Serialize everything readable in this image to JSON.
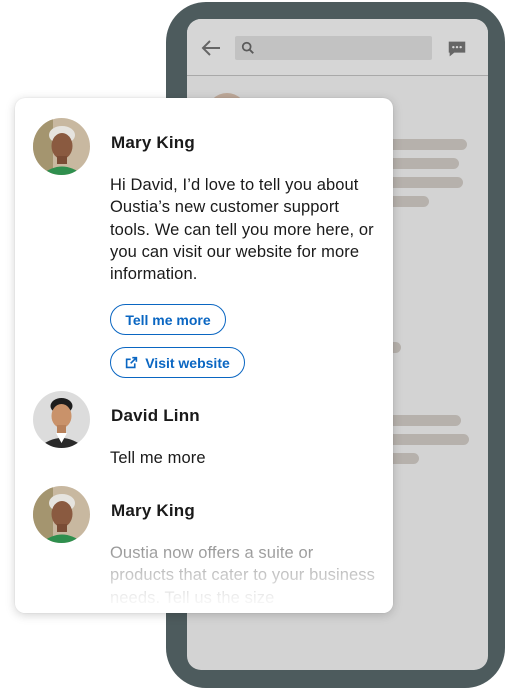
{
  "background_phone": {
    "icons": [
      "back-arrow-icon",
      "search-icon",
      "messaging-icon"
    ]
  },
  "conversation": {
    "messages": [
      {
        "sender": "Mary King",
        "avatar": "mary-king-avatar",
        "text": "Hi David, I’d love to tell you about Oustia’s new customer support tools. We can tell you more here, or you can visit our website for more information.",
        "actions": [
          {
            "label": "Tell me more",
            "icon": ""
          },
          {
            "label": "Visit website",
            "icon": "external-link-icon"
          }
        ]
      },
      {
        "sender": "David Linn",
        "avatar": "david-linn-avatar",
        "text": "Tell me more"
      },
      {
        "sender": "Mary King",
        "avatar": "mary-king-avatar",
        "text": "Oustia now offers a suite or products that cater to your business needs. Tell us the size"
      }
    ]
  },
  "colors": {
    "accent": "#0a66c2",
    "phone_frame": "#4d5b5d",
    "screen_bg": "#d3d3d3",
    "placeholder": "#b6b1ac"
  }
}
